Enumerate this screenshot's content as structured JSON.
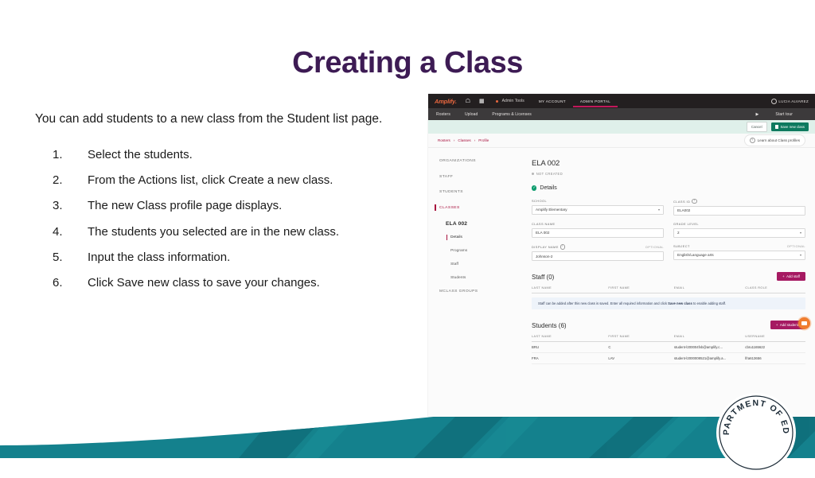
{
  "slide": {
    "title": "Creating a Class",
    "lead": "You can add students to a new class from the Student list page.",
    "steps": [
      {
        "num": "1.",
        "text": "Select the students."
      },
      {
        "num": "2.",
        "text": "From the Actions list, click Create a new class."
      },
      {
        "num": "3.",
        "text": "The new Class profile page displays."
      },
      {
        "num": "4.",
        "text": "The students you selected are in the new class."
      },
      {
        "num": "5.",
        "text": "Input the class information."
      },
      {
        "num": "6.",
        "text": "Click Save new class to save your changes."
      }
    ],
    "colors": {
      "title": "#3d1b54",
      "wave": "#14808c",
      "wave_dark": "#0d6e79"
    }
  },
  "app": {
    "topnav": {
      "logo": "Amplify.",
      "home_icon": "home-icon",
      "grid_icon": "grid-icon",
      "admin_tools": "Admin Tools",
      "tabs": [
        {
          "label": "MY ACCOUNT",
          "active": false
        },
        {
          "label": "ADMIN PORTAL",
          "active": true
        }
      ],
      "user": "LUCIA ALVAREZ"
    },
    "subnav": {
      "items": [
        "Rosters",
        "Upload",
        "Programs & Licenses"
      ],
      "start_tour": "Start tour"
    },
    "actionbar": {
      "cancel": "Cancel",
      "save": "Save new class"
    },
    "breadcrumb": {
      "items": [
        "Rosters",
        "Classes",
        "Profile"
      ],
      "separator": "›",
      "learn": "Learn about Class profiles"
    },
    "sidebar": {
      "groups": [
        "ORGANIZATIONS",
        "STAFF",
        "STUDENTS"
      ],
      "classes_label": "CLASSES",
      "class_name": "ELA 002",
      "subitems": [
        "Details",
        "Programs",
        "Staff",
        "Students"
      ],
      "mclass": "MCLASS GROUPS",
      "active_group": "CLASSES",
      "active_sub": "Details"
    },
    "main": {
      "title": "ELA 002",
      "status": "NOT CREATED",
      "details_heading": "Details",
      "fields": [
        {
          "label": "SCHOOL",
          "value": "Amplify Elementary",
          "type": "select",
          "optional": false,
          "info": false
        },
        {
          "label": "CLASS ID",
          "value": "ELA002",
          "type": "text",
          "optional": false,
          "info": true
        },
        {
          "label": "CLASS NAME",
          "value": "ELA 002",
          "type": "text",
          "optional": false,
          "info": false
        },
        {
          "label": "GRADE LEVEL",
          "value": "2",
          "type": "select",
          "optional": false,
          "info": false
        },
        {
          "label": "DISPLAY NAME",
          "value": "Johnson-2",
          "type": "text",
          "optional": true,
          "info": true
        },
        {
          "label": "SUBJECT",
          "value": "English/Language arts",
          "type": "select",
          "optional": true,
          "info": false
        }
      ],
      "optional_label": "OPTIONAL",
      "staff": {
        "heading": "Staff (0)",
        "add_button": "Add staff",
        "columns": [
          "LAST NAME",
          "FIRST NAME",
          "EMAIL",
          "CLASS ROLE"
        ],
        "notice_pre": "Staff can be added after this new class is saved. Enter all required information and click ",
        "notice_bold": "Save new class",
        "notice_post": " to enable adding staff."
      },
      "students": {
        "heading": "Students (6)",
        "add_button": "Add students",
        "columns": [
          "LAST NAME",
          "FIRST NAME",
          "EMAIL",
          "USERNAME"
        ],
        "rows": [
          {
            "last": "BRU",
            "first": "C",
            "email": "student-l200004fvb@amplify.c...",
            "username": "cbru1165622"
          },
          {
            "last": "FRA",
            "first": "LAV",
            "email": "student-l2000008521@amplify.a...",
            "username": "lfra613656"
          }
        ]
      }
    },
    "chat_icon": "chat-bubble-icon"
  },
  "seal": {
    "text": "DEPARTMENT OF EDUC"
  }
}
